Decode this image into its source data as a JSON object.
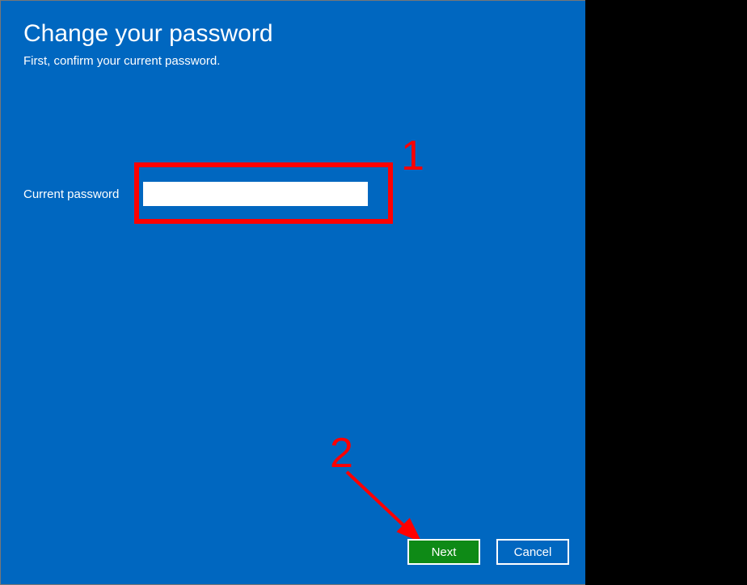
{
  "title": "Change your password",
  "subtitle": "First, confirm your current password.",
  "field": {
    "label": "Current password",
    "value": ""
  },
  "buttons": {
    "next": "Next",
    "cancel": "Cancel"
  },
  "annotations": {
    "one": "1",
    "two": "2"
  }
}
